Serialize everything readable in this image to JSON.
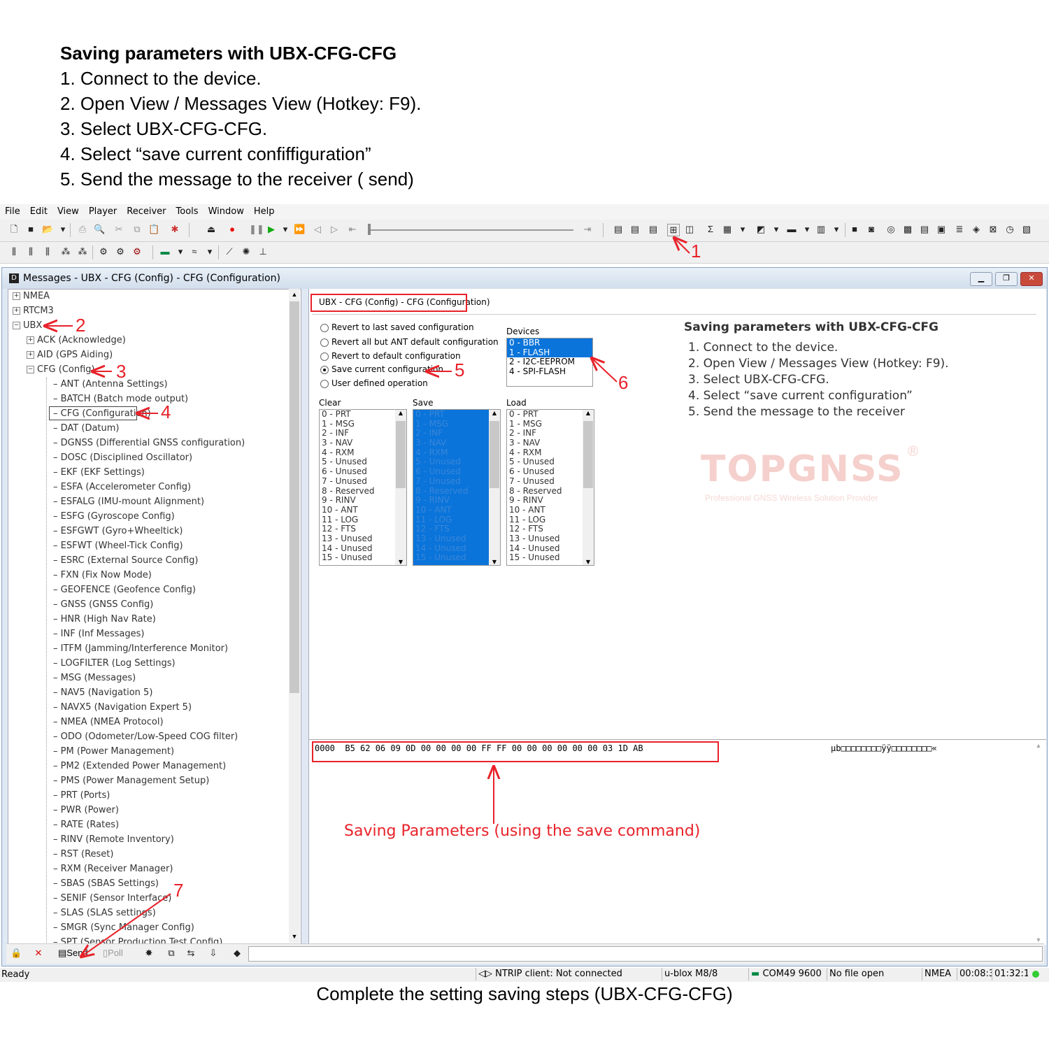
{
  "instructions": {
    "title": "Saving parameters with UBX-CFG-CFG",
    "steps": [
      "1. Connect to the device.",
      "2. Open View / Messages View (Hotkey: F9).",
      "3. Select UBX-CFG-CFG.",
      "4. Select “save current confiffiguration”",
      "5. Send the message to the receiver (  send)"
    ]
  },
  "menu": [
    "File",
    "Edit",
    "View",
    "Player",
    "Receiver",
    "Tools",
    "Window",
    "Help"
  ],
  "window": {
    "title": "Messages - UBX - CFG (Config) - CFG (Configuration)"
  },
  "tree": {
    "top": [
      "NMEA",
      "RTCM3",
      "UBX"
    ],
    "ubx_children": [
      "ACK (Acknowledge)",
      "AID (GPS Aiding)",
      "CFG (Config)"
    ],
    "cfg_children": [
      "ANT (Antenna Settings)",
      "BATCH (Batch mode output)",
      "CFG (Configuration)",
      "DAT (Datum)",
      "DGNSS (Differential GNSS configuration)",
      "DOSC (Disciplined Oscillator)",
      "EKF (EKF Settings)",
      "ESFA (Accelerometer Config)",
      "ESFALG (IMU-mount Alignment)",
      "ESFG (Gyroscope Config)",
      "ESFGWT (Gyro+Wheeltick)",
      "ESFWT (Wheel-Tick Config)",
      "ESRC (External Source Config)",
      "FXN (Fix Now Mode)",
      "GEOFENCE (Geofence Config)",
      "GNSS (GNSS Config)",
      "HNR (High Nav Rate)",
      "INF (Inf Messages)",
      "ITFM (Jamming/Interference Monitor)",
      "LOGFILTER (Log Settings)",
      "MSG (Messages)",
      "NAV5 (Navigation 5)",
      "NAVX5 (Navigation Expert 5)",
      "NMEA (NMEA Protocol)",
      "ODO (Odometer/Low-Speed COG filter)",
      "PM (Power Management)",
      "PM2 (Extended Power Management)",
      "PMS (Power Management Setup)",
      "PRT (Ports)",
      "PWR (Power)",
      "RATE (Rates)",
      "RINV (Remote Inventory)",
      "RST (Reset)",
      "RXM (Receiver Manager)",
      "SBAS (SBAS Settings)",
      "SENIF (Sensor Interface)",
      "SLAS (SLAS settings)",
      "SMGR (Sync Manager Config)",
      "SPT (Sensor Production Test Config)"
    ]
  },
  "panel": {
    "header": "UBX - CFG (Config) - CFG (Configuration)",
    "radios": [
      "Revert to last saved configuration",
      "Revert all but ANT default configuration",
      "Revert to default configuration",
      "Save current configuration",
      "User defined operation"
    ],
    "selected_radio": 3,
    "devices_label": "Devices",
    "devices": [
      "0 - BBR",
      "1 - FLASH",
      "2 - I2C-EEPROM",
      "4 - SPI-FLASH"
    ],
    "clear_label": "Clear",
    "save_label": "Save",
    "load_label": "Load",
    "masks": [
      "0 - PRT",
      "1 - MSG",
      "2 - INF",
      "3 - NAV",
      "4 - RXM",
      "5 - Unused",
      "6 - Unused",
      "7 - Unused",
      "8 - Reserved",
      "9 - RINV",
      "10 - ANT",
      "11 - LOG",
      "12 - FTS",
      "13 - Unused",
      "14 - Unused",
      "15 - Unused"
    ]
  },
  "info": {
    "title": "Saving parameters with UBX-CFG-CFG",
    "steps": [
      "1. Connect to the device.",
      "2. Open View / Messages View (Hotkey: F9).",
      "3. Select UBX-CFG-CFG.",
      "4. Select   “save current configuration”",
      "5. Send the message to the receiver"
    ],
    "watermark": "TOPGNSS",
    "watermark_reg": "®",
    "watermark_sub": "Professional GNSS Wireless Solution Provider"
  },
  "hex": {
    "line": "0000  B5 62 06 09 0D 00 00 00 00 FF FF 00 00 00 00 00 00 03 1D AB",
    "ascii": "µb□□□□□□□□ÿÿ□□□□□□□□«"
  },
  "annotation_text": "Saving Parameters (using the save command)",
  "markers": [
    "1",
    "2",
    "3",
    "4",
    "5",
    "6",
    "7"
  ],
  "bottom": {
    "send": "Send",
    "poll": "Poll"
  },
  "status": {
    "ready": "Ready",
    "ntrip": "NTRIP client: Not connected",
    "receiver": "u-blox M8/8",
    "port": "COM49 9600",
    "file": "No file open",
    "protocol": "NMEA",
    "time1": "00:08:3",
    "time2": "01:32:1"
  },
  "caption": "Complete the setting saving steps (UBX-CFG-CFG)"
}
